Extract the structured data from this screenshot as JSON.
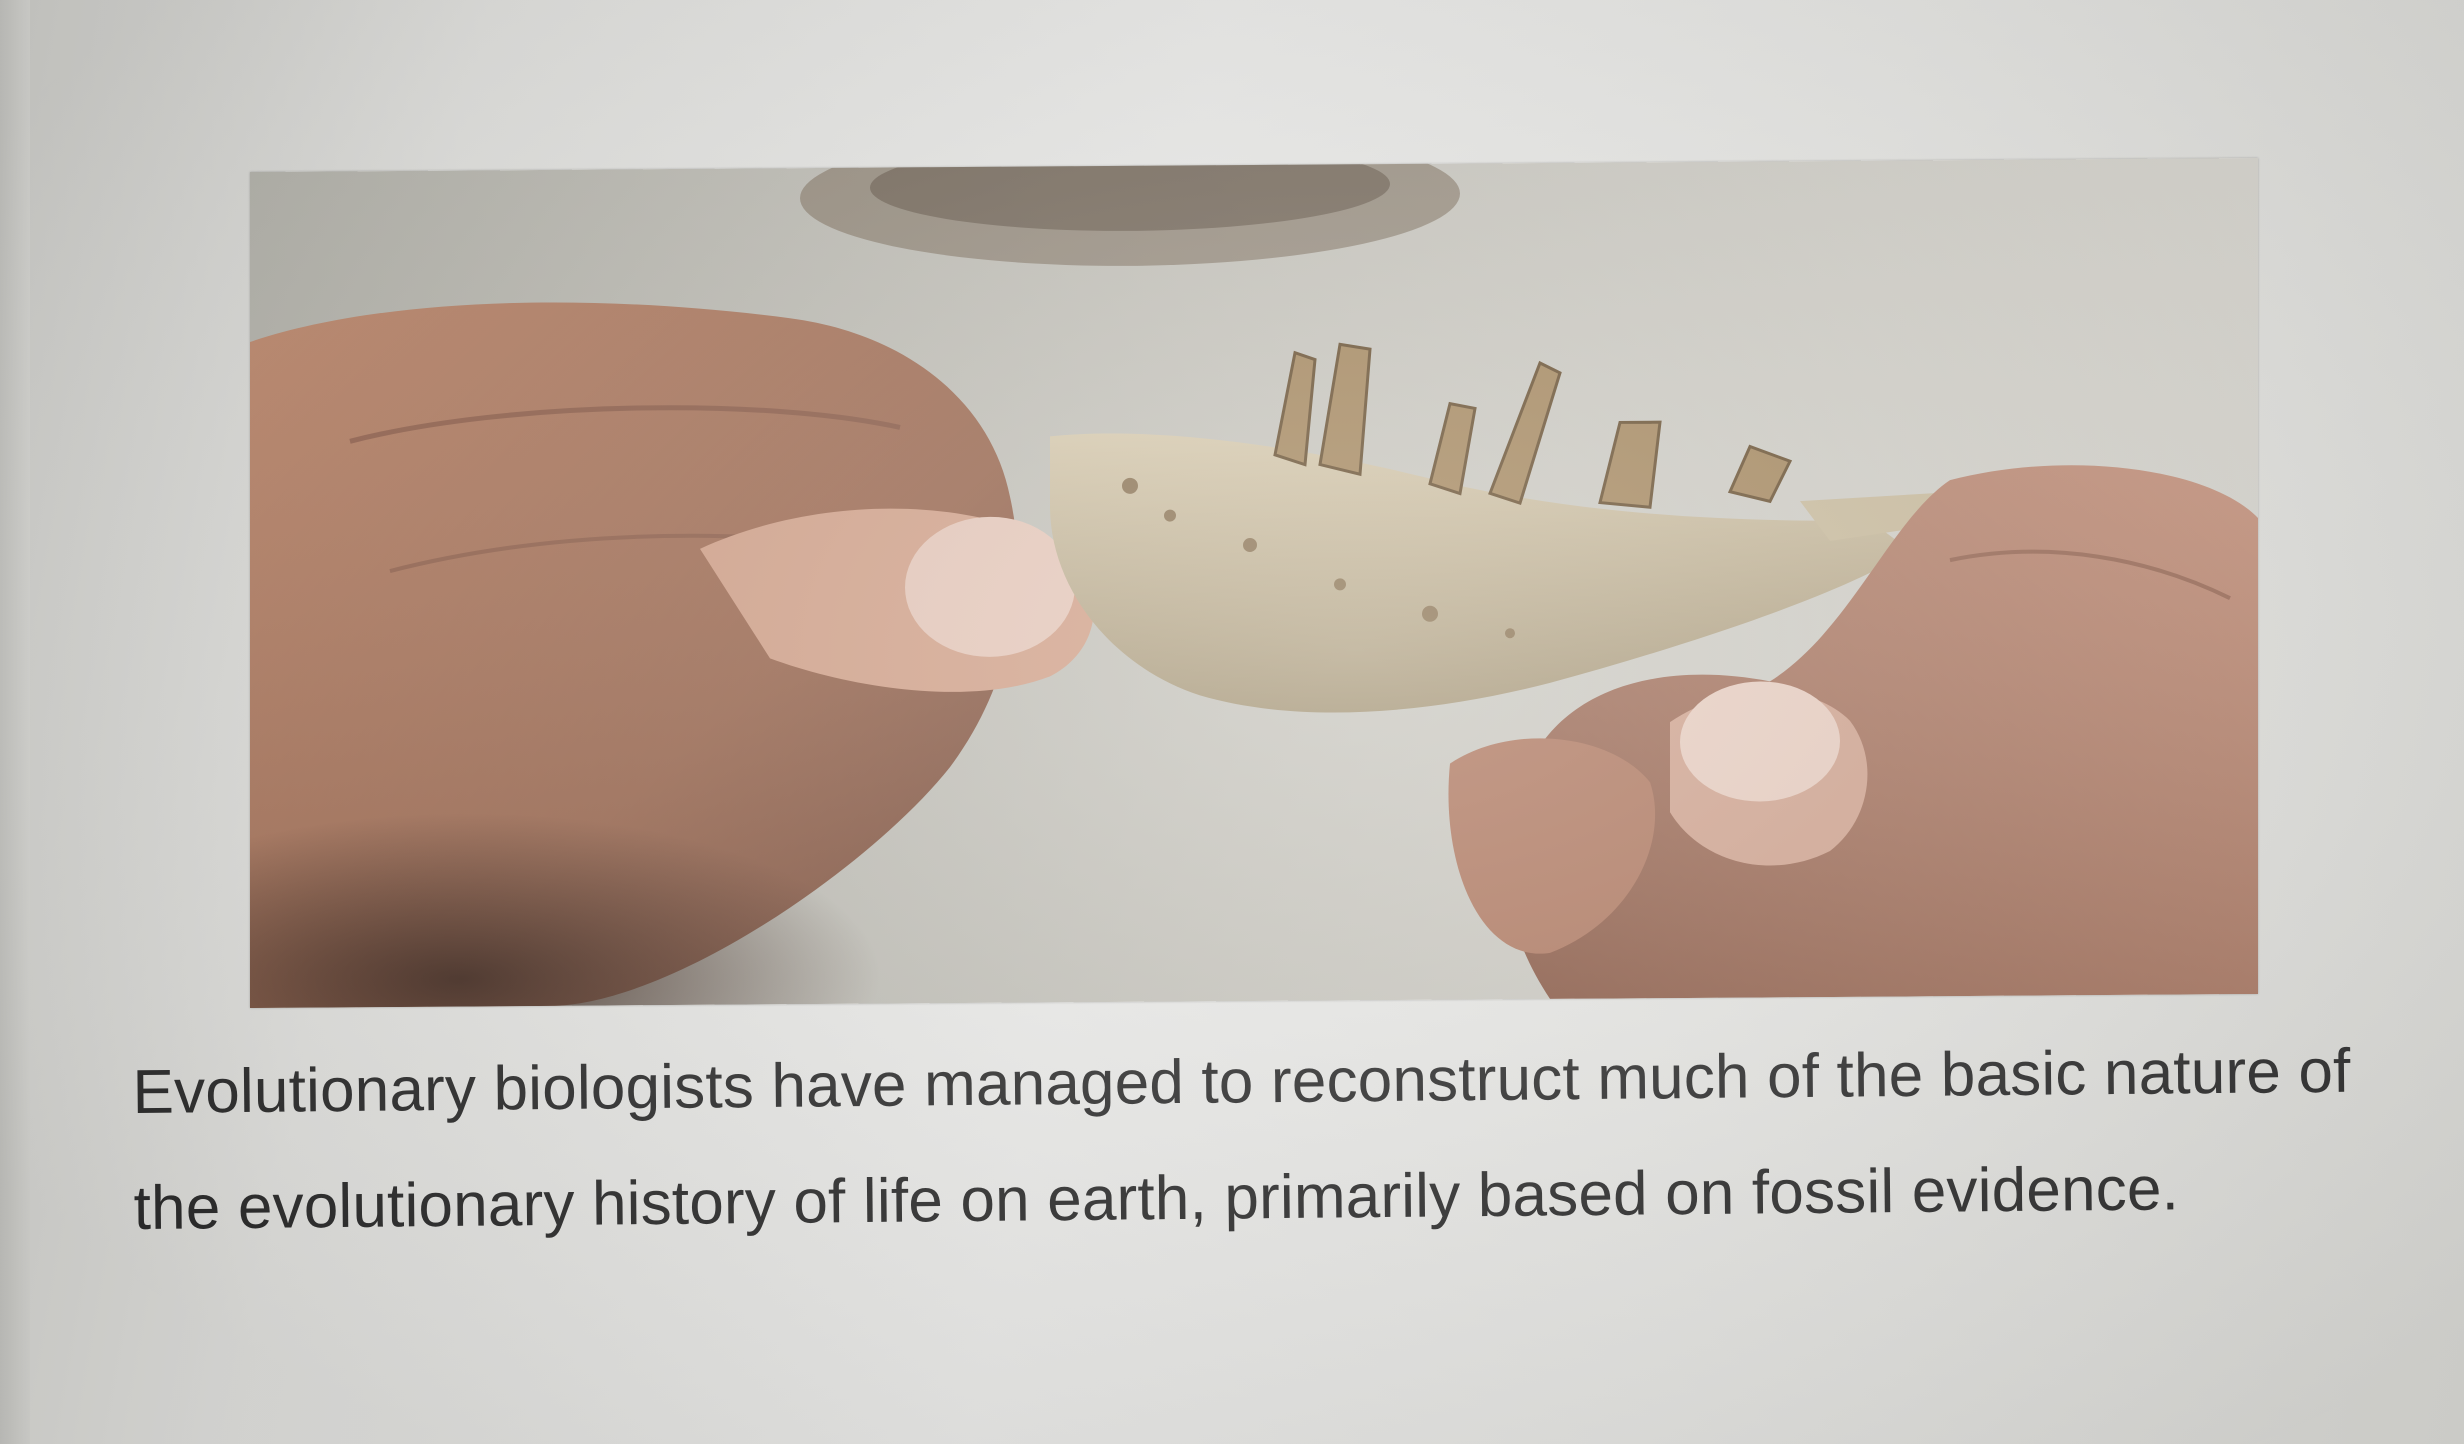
{
  "figure": {
    "image_subject": "fossil-jawbone-with-teeth-held-in-hands"
  },
  "caption": {
    "text": "Evolutionary biologists have managed to reconstruct much of the basic nature of the evolutionary history of life on earth, primarily based on fossil evidence."
  }
}
